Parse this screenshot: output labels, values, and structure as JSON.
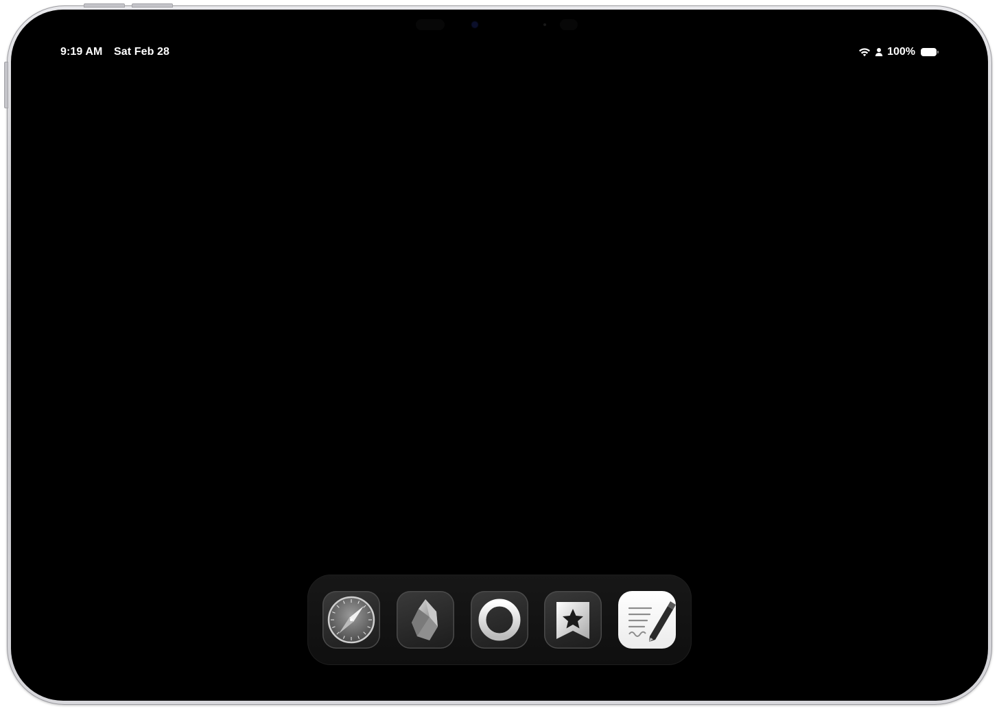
{
  "status_bar": {
    "time": "9:19 AM",
    "date": "Sat Feb 28",
    "battery": "100%",
    "icons": [
      "wifi-icon",
      "person-icon",
      "battery-icon"
    ]
  },
  "dock": {
    "apps": [
      {
        "icon": "safari-compass-icon"
      },
      {
        "icon": "obsidian-gem-icon"
      },
      {
        "icon": "ring-icon"
      },
      {
        "icon": "bookmark-star-icon"
      },
      {
        "icon": "notes-pen-icon"
      }
    ]
  },
  "colors": {
    "screen": "#000000",
    "dock": "#141414",
    "status_text": "#ffffff"
  }
}
